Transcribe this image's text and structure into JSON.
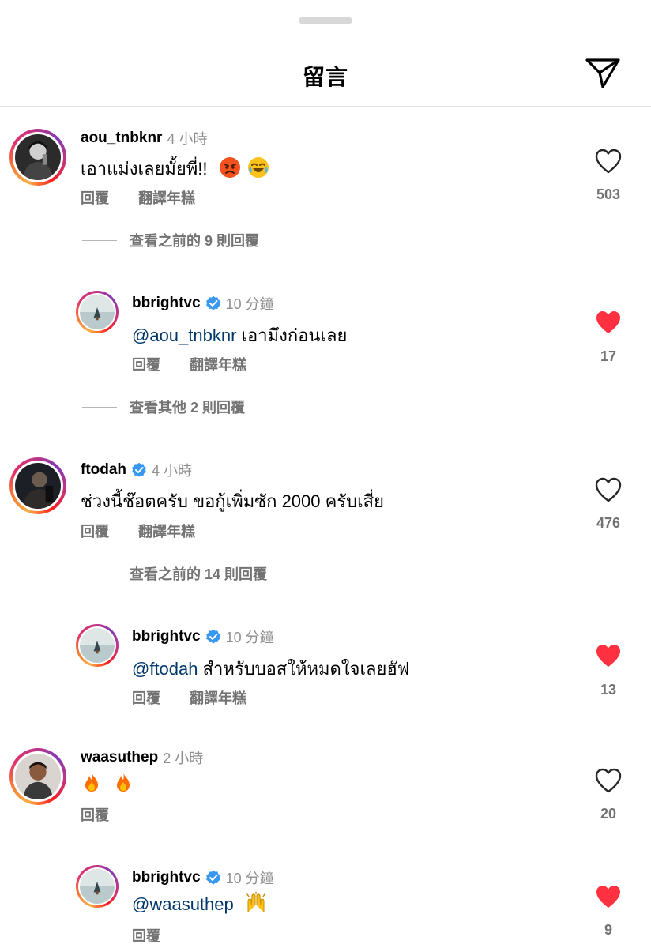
{
  "header": {
    "title": "留言",
    "share_icon": "send-icon"
  },
  "colors": {
    "like_red": "#ff3040",
    "mention": "#00376b",
    "muted": "#737373",
    "verified": "#3897f0"
  },
  "comments": [
    {
      "username": "aou_tnbknr",
      "time": "4 小時",
      "text": "เอาแม่งเลยมั้ยพี่!!",
      "emojis": [
        "angry-face-emoji",
        "tears-of-joy-emoji"
      ],
      "reply_label": "回覆",
      "translate_label": "翻譯年糕",
      "likes": "503",
      "liked": false,
      "view_replies": "查看之前的 9 則回覆",
      "reply": {
        "username": "bbrightvc",
        "verified": true,
        "time": "10 分鐘",
        "mention": "@aou_tnbknr",
        "text": " เอามึงก่อนเลย",
        "reply_label": "回覆",
        "translate_label": "翻譯年糕",
        "likes": "17",
        "liked": true
      },
      "view_more": "查看其他 2 則回覆"
    },
    {
      "username": "ftodah",
      "verified": true,
      "time": "4 小時",
      "text": "ช่วงนี้ช๊อตครับ ขอกู้เพิ่มซัก 2000 ครับเสี่ย",
      "reply_label": "回覆",
      "translate_label": "翻譯年糕",
      "likes": "476",
      "liked": false,
      "view_replies": "查看之前的 14 則回覆",
      "reply": {
        "username": "bbrightvc",
        "verified": true,
        "time": "10 分鐘",
        "mention": "@ftodah",
        "text": " สำหรับบอสให้หมดใจเลยฮัฟ",
        "reply_label": "回覆",
        "translate_label": "翻譯年糕",
        "likes": "13",
        "liked": true
      }
    },
    {
      "username": "waasuthep",
      "time": "2 小時",
      "emojis": [
        "fire-emoji",
        "fire-emoji"
      ],
      "reply_label": "回覆",
      "likes": "20",
      "liked": false,
      "reply": {
        "username": "bbrightvc",
        "verified": true,
        "time": "10 分鐘",
        "mention": "@waasuthep",
        "emojis": [
          "raising-hands-emoji"
        ],
        "reply_label": "回覆",
        "likes": "9",
        "liked": true
      }
    }
  ]
}
